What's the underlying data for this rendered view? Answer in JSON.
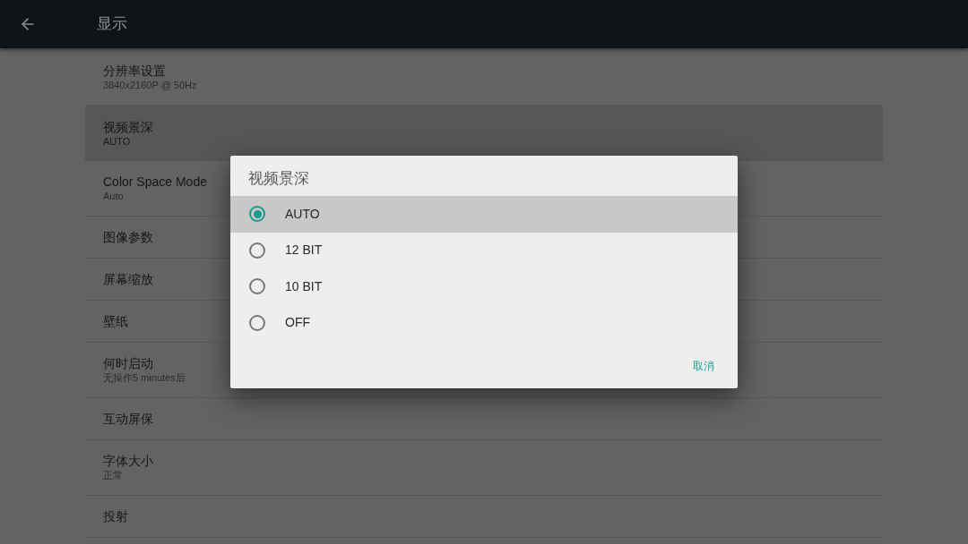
{
  "header": {
    "title": "显示"
  },
  "settings": [
    {
      "label": "分辨率设置",
      "value": "3840x2160P @ 50Hz",
      "selected": false
    },
    {
      "label": "视频景深",
      "value": "AUTO",
      "selected": true
    },
    {
      "label": "Color Space Mode",
      "value": "Auto",
      "selected": false
    },
    {
      "label": "图像参数",
      "selected": false
    },
    {
      "label": "屏幕缩放",
      "selected": false
    },
    {
      "label": "壁纸",
      "selected": false
    },
    {
      "label": "何时启动",
      "value": "无操作5 minutes后",
      "selected": false
    },
    {
      "label": "互动屏保",
      "selected": false
    },
    {
      "label": "字体大小",
      "value": "正常",
      "selected": false
    },
    {
      "label": "投射",
      "selected": false
    }
  ],
  "dialog": {
    "title": "视频景深",
    "options": [
      {
        "label": "AUTO",
        "selected": true
      },
      {
        "label": "12 BIT",
        "selected": false
      },
      {
        "label": "10 BIT",
        "selected": false
      },
      {
        "label": "OFF",
        "selected": false
      }
    ],
    "cancel": "取消"
  }
}
